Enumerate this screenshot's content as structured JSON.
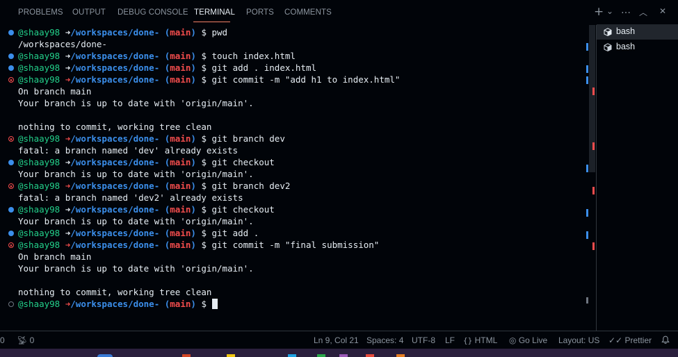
{
  "panel": {
    "tabs": [
      {
        "label": "PROBLEMS"
      },
      {
        "label": "OUTPUT"
      },
      {
        "label": "DEBUG CONSOLE"
      },
      {
        "label": "TERMINAL"
      },
      {
        "label": "PORTS"
      },
      {
        "label": "COMMENTS"
      }
    ],
    "active_tab": "TERMINAL",
    "actions": {
      "new_terminal": "+",
      "dropdown": "⌄",
      "more": "…",
      "maximize": "︿",
      "close": "✕"
    }
  },
  "terminal": {
    "prompt": {
      "user": "@shaay98",
      "arrow": "➜",
      "path": "/workspaces/done-",
      "paren_open": "(",
      "branch": "main",
      "paren_close": ")",
      "dollar": "$"
    },
    "lines": [
      {
        "kind": "prompt",
        "status": "ok",
        "cmd": "pwd"
      },
      {
        "kind": "output",
        "text": "/workspaces/done-"
      },
      {
        "kind": "prompt",
        "status": "ok",
        "cmd": "touch index.html"
      },
      {
        "kind": "prompt",
        "status": "ok",
        "cmd": "git add . index.html"
      },
      {
        "kind": "prompt",
        "status": "err",
        "cmd": "git commit -m \"add h1 to index.html\""
      },
      {
        "kind": "output",
        "text": "On branch main"
      },
      {
        "kind": "output",
        "text": "Your branch is up to date with 'origin/main'."
      },
      {
        "kind": "output",
        "text": ""
      },
      {
        "kind": "output",
        "text": "nothing to commit, working tree clean"
      },
      {
        "kind": "prompt",
        "status": "err",
        "cmd": "git branch dev"
      },
      {
        "kind": "output",
        "text": "fatal: a branch named 'dev' already exists"
      },
      {
        "kind": "prompt",
        "status": "ok",
        "cmd": "git checkout"
      },
      {
        "kind": "output",
        "text": "Your branch is up to date with 'origin/main'."
      },
      {
        "kind": "prompt",
        "status": "err",
        "cmd": "git branch dev2"
      },
      {
        "kind": "output",
        "text": "fatal: a branch named 'dev2' already exists"
      },
      {
        "kind": "prompt",
        "status": "ok",
        "cmd": "git checkout"
      },
      {
        "kind": "output",
        "text": "Your branch is up to date with 'origin/main'."
      },
      {
        "kind": "prompt",
        "status": "ok",
        "cmd": "git add ."
      },
      {
        "kind": "prompt",
        "status": "err",
        "cmd": "git commit -m \"final submission\""
      },
      {
        "kind": "output",
        "text": "On branch main"
      },
      {
        "kind": "output",
        "text": "Your branch is up to date with 'origin/main'."
      },
      {
        "kind": "output",
        "text": ""
      },
      {
        "kind": "output",
        "text": "nothing to commit, working tree clean"
      },
      {
        "kind": "prompt",
        "status": "pending",
        "cmd": "",
        "cursor": true
      }
    ]
  },
  "terminal_list": [
    {
      "label": "bash",
      "selected": true,
      "icon": "terminal-bash-icon"
    },
    {
      "label": "bash",
      "selected": false,
      "icon": "terminal-bash-icon"
    }
  ],
  "status_bar": {
    "errors": "0",
    "ports_icon": "radio-tower-icon",
    "ports": "0",
    "position": "Ln 9, Col 21",
    "spaces": "Spaces: 4",
    "encoding": "UTF-8",
    "eol": "LF",
    "language_icon": "braces-icon",
    "language": "HTML",
    "golive_icon": "broadcast-icon",
    "golive": "Go Live",
    "layout": "Layout: US",
    "prettier_icon": "check-all-icon",
    "prettier": "Prettier",
    "notifications_icon": "bell-icon"
  },
  "colors": {
    "background": "#010409",
    "user_green": "#23d18b",
    "path_blue": "#3b8eea",
    "branch_red": "#f14c4c",
    "active_tab_underline": "#f78166"
  }
}
